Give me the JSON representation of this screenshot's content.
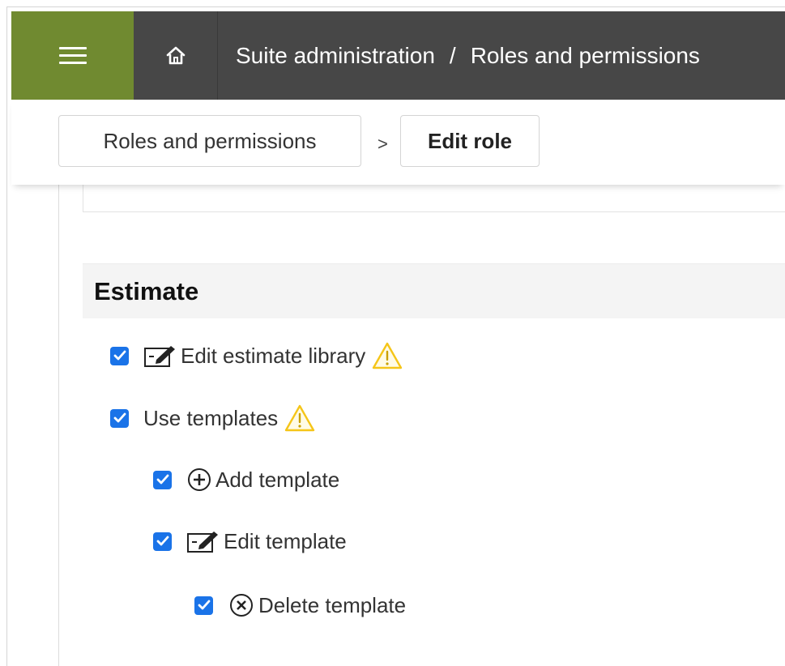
{
  "topbar": {
    "menu_icon": "hamburger-menu-icon",
    "home_icon": "home-icon",
    "title_part1": "Suite administration",
    "title_sep": "/",
    "title_part2": "Roles and permissions"
  },
  "breadcrumbs": {
    "item1": "Roles and permissions",
    "separator": ">",
    "item2": "Edit role"
  },
  "section": {
    "title": "Estimate"
  },
  "permissions": [
    {
      "label": "Edit estimate library",
      "checked": true,
      "icon": "edit-icon",
      "warning": true
    },
    {
      "label": "Use templates",
      "checked": true,
      "icon": null,
      "warning": true
    },
    {
      "label": "Add template",
      "checked": true,
      "icon": "add-circle-icon",
      "warning": false
    },
    {
      "label": "Edit template",
      "checked": true,
      "icon": "edit-icon",
      "warning": false
    },
    {
      "label": "Delete template",
      "checked": true,
      "icon": "delete-circle-icon",
      "warning": false
    }
  ],
  "colors": {
    "topbar_bg": "#474747",
    "menu_button_bg": "#708a30",
    "checkbox_blue": "#1a73e8",
    "warning_yellow": "#f5c518"
  }
}
